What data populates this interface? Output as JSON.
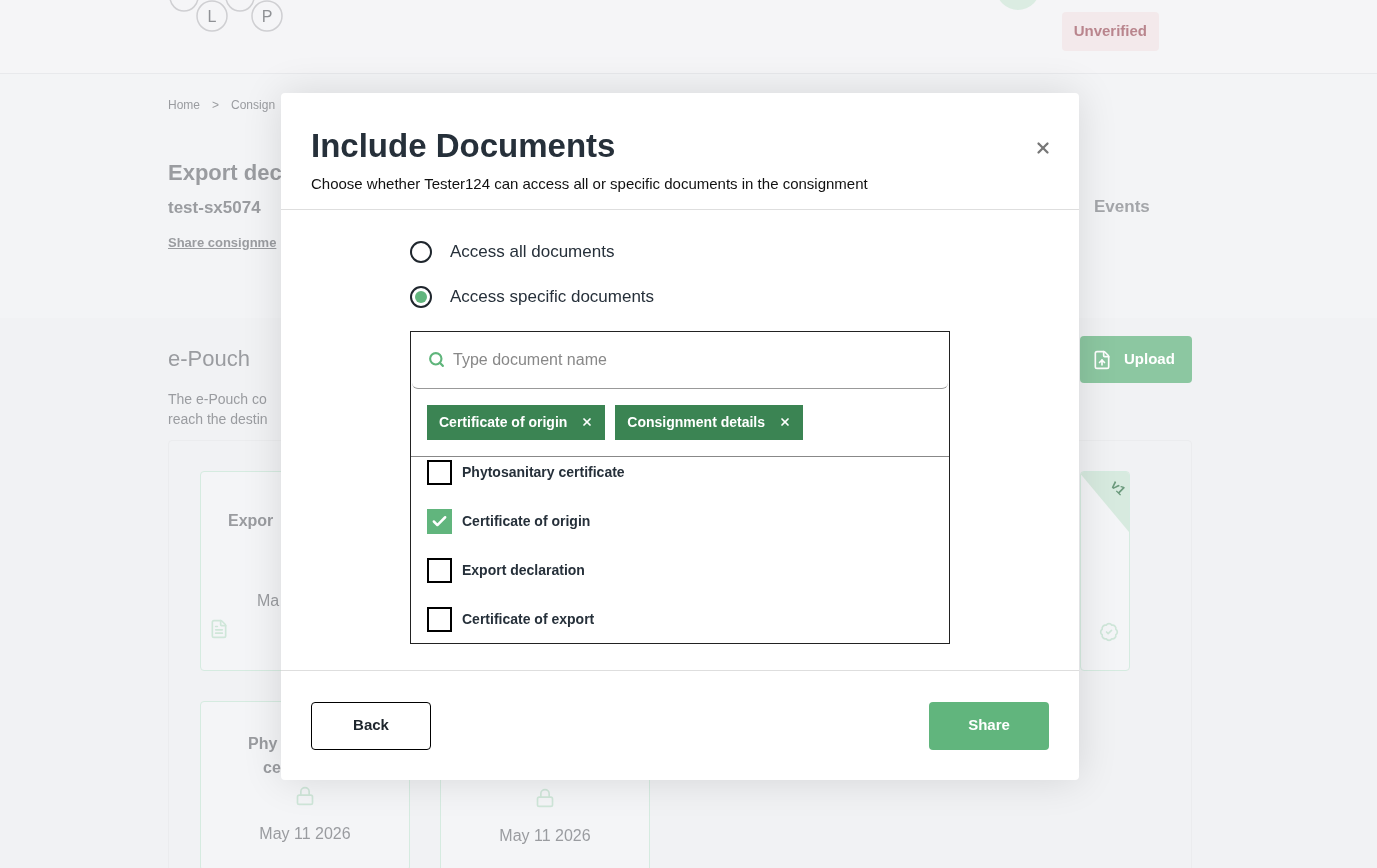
{
  "header": {
    "logo_letters": [
      "L",
      "P"
    ],
    "status_badge": "Unverified"
  },
  "breadcrumb": [
    "Home",
    ">",
    "Consign"
  ],
  "consignment": {
    "title": "Export dec",
    "reference": "test-sx5074",
    "share_link": "Share consignme",
    "tab": "Events"
  },
  "epouch": {
    "title": "e-Pouch",
    "description": [
      "The e-Pouch co",
      "reach the destin"
    ],
    "upload_button": "Upload",
    "cards": [
      {
        "kind": "file",
        "title": [
          "Expor"
        ],
        "date": "Ma"
      },
      {
        "kind": "verified",
        "version": "v1"
      },
      {
        "kind": "locked",
        "title": [
          "Phy",
          "ce"
        ],
        "date": "May 11 2026"
      },
      {
        "kind": "locked",
        "date": "May 11 2026"
      }
    ]
  },
  "modal": {
    "title": "Include Documents",
    "subtitle": "Choose whether Tester124 can access all or specific documents in the consignment",
    "access_options": [
      {
        "label": "Access all documents",
        "selected": false
      },
      {
        "label": "Access specific documents",
        "selected": true
      }
    ],
    "search": {
      "placeholder": "Type document name"
    },
    "chips": [
      "Certificate of origin",
      "Consignment details"
    ],
    "documents": [
      {
        "label": "Phytosanitary certificate",
        "checked": false
      },
      {
        "label": "Certificate of origin",
        "checked": true
      },
      {
        "label": "Export declaration",
        "checked": false
      },
      {
        "label": "Certificate of export",
        "checked": false
      }
    ],
    "buttons": {
      "back": "Back",
      "share": "Share"
    }
  }
}
